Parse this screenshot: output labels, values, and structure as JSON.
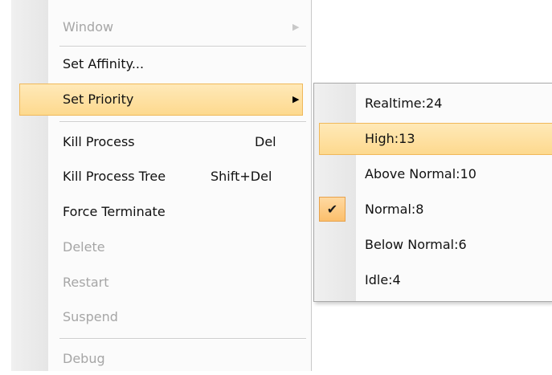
{
  "menu": {
    "items": [
      {
        "label": "Window",
        "disabled": true,
        "submenu": true
      },
      {
        "label": "Set Affinity..."
      },
      {
        "label": "Set Priority",
        "highlighted": true,
        "submenu": true
      },
      {
        "label": "Kill Process",
        "shortcut": "Del"
      },
      {
        "label": "Kill Process Tree",
        "shortcut": "Shift+Del"
      },
      {
        "label": "Force Terminate"
      },
      {
        "label": "Delete",
        "disabled": true
      },
      {
        "label": "Restart",
        "disabled": true
      },
      {
        "label": "Suspend",
        "disabled": true
      },
      {
        "label": "Debug",
        "disabled": true
      }
    ]
  },
  "priority_submenu": {
    "items": [
      {
        "label": "Realtime:24"
      },
      {
        "label": "High:13",
        "highlighted": true
      },
      {
        "label": "Above Normal:10"
      },
      {
        "label": "Normal:8",
        "checked": true
      },
      {
        "label": "Below Normal:6"
      },
      {
        "label": "Idle:4"
      }
    ]
  },
  "icons": {
    "submenu_arrow": "arrow-right-icon",
    "check": "checkmark-icon"
  },
  "colors": {
    "highlight_fill": "#fdd98e",
    "highlight_border": "#f0b85a",
    "disabled_text": "#a6a6a6"
  }
}
